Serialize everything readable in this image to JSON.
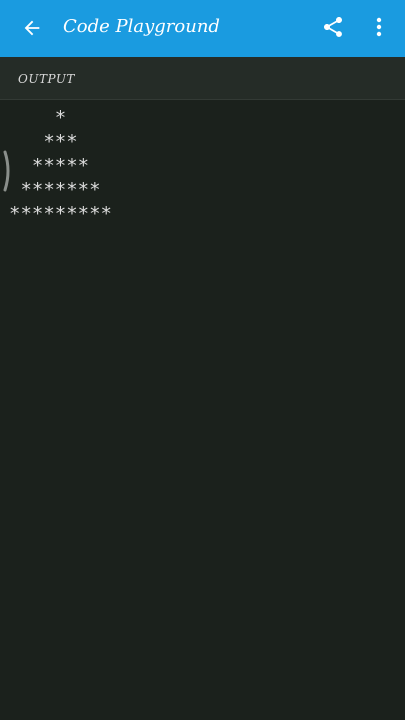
{
  "app_bar": {
    "title": "Code Playground",
    "background_color": "#1a9be0",
    "back_icon": "arrow-left-icon",
    "share_icon": "share-icon",
    "more_icon": "more-vert-icon"
  },
  "output": {
    "label": "OUTPUT",
    "background_color": "#1b211c",
    "lines": [
      "    *",
      "   ***",
      "  *****",
      " *******",
      "*********"
    ]
  }
}
